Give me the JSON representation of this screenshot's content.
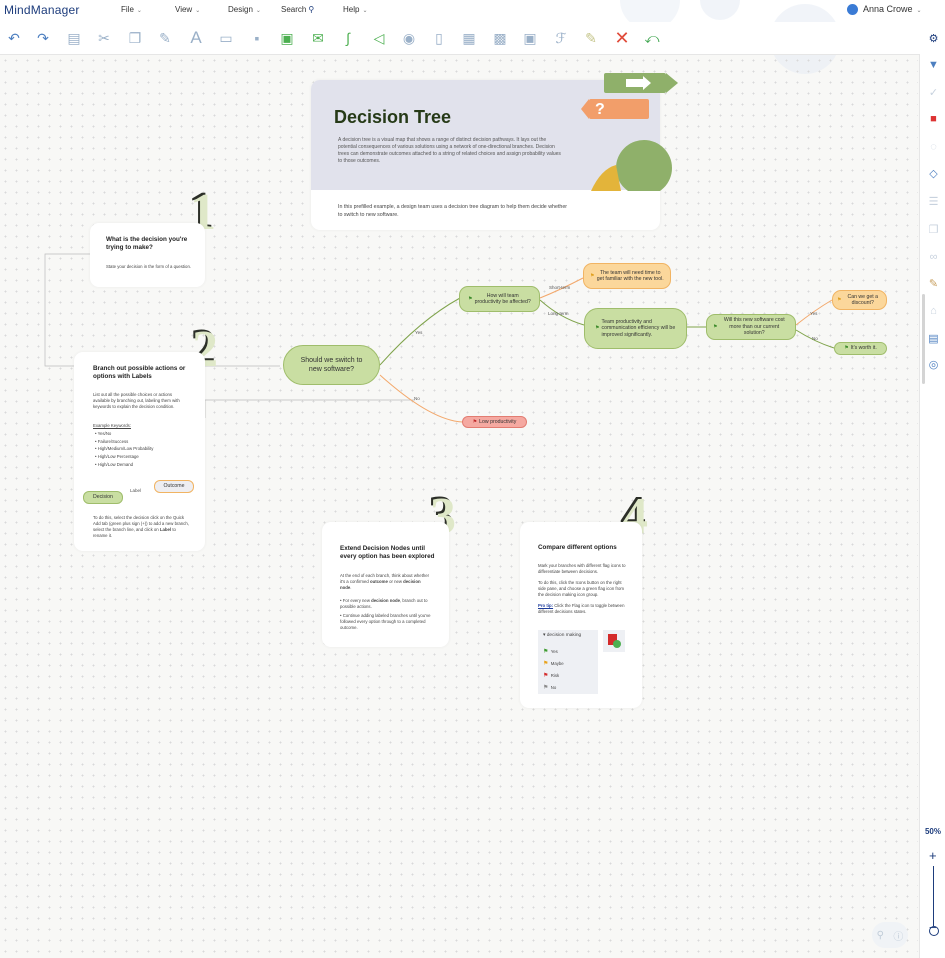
{
  "app": {
    "logo": "MindManager",
    "user_name": "Anna Crowe"
  },
  "menu": [
    {
      "label": "File"
    },
    {
      "label": "View"
    },
    {
      "label": "Design"
    },
    {
      "label": "Search"
    },
    {
      "label": "Help"
    }
  ],
  "toolbar_icons": [
    "undo-icon",
    "redo-icon",
    "paste-icon",
    "cut-icon",
    "copy-icon",
    "format-painter-icon",
    "text-icon",
    "topic-icon",
    "subtopic-icon",
    "callout-icon",
    "comment-icon",
    "relationship-icon",
    "boundary-icon",
    "shape-icon",
    "bucket-icon",
    "image-icon",
    "layout-icon",
    "picture-icon",
    "text-style-icon",
    "clear-format-icon",
    "delete-icon",
    "share-icon"
  ],
  "rail_icons": [
    "settings-icon",
    "filter-icon",
    "check-icon",
    "task-icon",
    "comment-icon",
    "tag-icon",
    "list-icon",
    "copy-icon",
    "link-icon",
    "format-painter-icon",
    "building-icon",
    "image-icon",
    "lifebuoy-icon"
  ],
  "zoom": {
    "label": "50%",
    "level": 0.5
  },
  "header_card": {
    "title": "Decision Tree",
    "description": "A decision tree is a visual map that shows a range of distinct decision pathways. It lays out the potential consequences of various solutions using a network of one-directional branches. Decision trees can demonstrate outcomes attached to a string of related choices and assign probability values to those outcomes.",
    "footer": "In this prefilled example, a design team uses a decision tree diagram to help them decide whether to switch to new software."
  },
  "step1": {
    "number": "1",
    "title": "What is the decision you're trying to make?",
    "text": "State your decision in the form of a question."
  },
  "step2": {
    "number": "2",
    "title": "Branch out possible actions or options with Labels",
    "text": "List out all the possible choices or actions available by branching out, labeling them with keywords to explain the decision condition.",
    "keywords_heading": "Example Keywords:",
    "keywords": [
      "Yes/No",
      "Failure/Success",
      "High/Medium/Low Probability",
      "High/Low Percentage",
      "High/Low Demand"
    ],
    "demo_decision": "Decision",
    "demo_label": "Label",
    "demo_outcome": "Outcome",
    "instructions_a": "To do this, select the decision click on the Quick Add tab (green plus sign (+)) to add a new branch, select the branch line, and click on ",
    "instructions_bold": "Label",
    "instructions_b": " to rename it."
  },
  "step3": {
    "number": "3",
    "title": "Extend Decision Nodes until every option has been explored",
    "text_a": "At the end of each branch, think about whether it's a confirmed ",
    "text_bold1": "outcome",
    "text_b": " or new ",
    "text_bold2": "decision node",
    "text_c": ".",
    "bullet1_a": "For every new ",
    "bullet1_bold": "decision node",
    "bullet1_b": ", branch out to possible actions.",
    "bullet2": "Continue adding labeled branches until you've followed every option through to a completed outcome."
  },
  "step4": {
    "number": "4",
    "title": "Compare different options",
    "text1": "Mark your branches with different flag icons to differentiate between decisions.",
    "text2": "To do this, click the Icons button on the right side pane, and choose a green flag icon from the decision making icon group.",
    "protip_label": "Pro tip:",
    "protip_text": " Click the Flag icon to toggle between different decisions states.",
    "group_title": "decision making",
    "flags": [
      {
        "label": "Yes",
        "color": "#3d9b2f"
      },
      {
        "label": "Maybe",
        "color": "#e8a21a"
      },
      {
        "label": "Risk",
        "color": "#d42b2b"
      },
      {
        "label": "No",
        "color": "#8a8a8a"
      }
    ]
  },
  "tree": {
    "root": "Should we switch to new software?",
    "yes_label": "Yes",
    "no_label": "No",
    "q1": "How will team productivity be affected?",
    "short_term_label": "Short-term",
    "long_term_label": "Long-term",
    "short_outcome": "The team will need time to get familiar with the new tool.",
    "long_outcome": "Team productivity and communication efficiency will be improved significantly.",
    "q2": "Will this new software cost more than our current solution?",
    "q2_yes_label": "Yes",
    "q2_no_label": "No",
    "discount": "Can we get a discount?",
    "worth_it": "It's worth it.",
    "low_productivity": "Low productivity"
  }
}
